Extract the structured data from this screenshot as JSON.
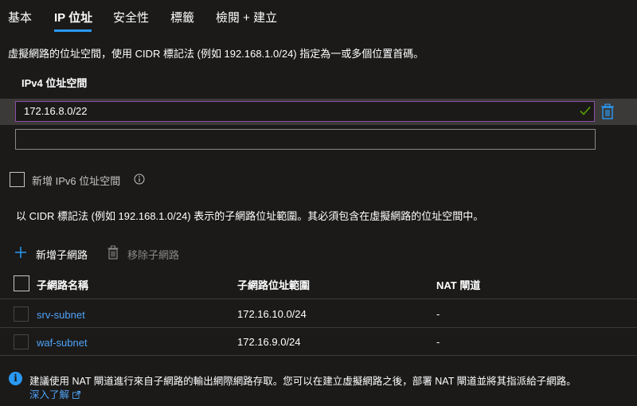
{
  "tabs": [
    {
      "label": "基本",
      "active": false
    },
    {
      "label": "IP 位址",
      "active": true
    },
    {
      "label": "安全性",
      "active": false
    },
    {
      "label": "標籤",
      "active": false
    },
    {
      "label": "檢閱 + 建立",
      "active": false
    }
  ],
  "address_space": {
    "description": "虛擬網路的位址空間，使用 CIDR 標記法 (例如 192.168.1.0/24) 指定為一或多個位置首碼。",
    "label": "IPv4 位址空間",
    "value": "172.16.8.0/22",
    "empty_value": ""
  },
  "ipv6": {
    "label": "新增 IPv6 位址空間",
    "checked": false
  },
  "subnet_description": "以 CIDR 標記法 (例如 192.168.1.0/24) 表示的子網路位址範圍。其必須包含在虛擬網路的位址空間中。",
  "toolbar": {
    "add_label": "新增子網路",
    "remove_label": "移除子網路"
  },
  "table": {
    "columns": [
      "子網路名稱",
      "子網路位址範圍",
      "NAT 閘道"
    ],
    "rows": [
      {
        "name": "srv-subnet",
        "range": "172.16.10.0/24",
        "nat": "-"
      },
      {
        "name": "waf-subnet",
        "range": "172.16.9.0/24",
        "nat": "-"
      }
    ]
  },
  "info": {
    "text": "建議使用 NAT 閘道進行來自子網路的輸出網際網路存取。您可以在建立虛擬網路之後，部署 NAT 閘道並將其指派給子網路。",
    "link": "深入了解"
  },
  "colors": {
    "background": "#1b1a19",
    "accent": "#2899f5",
    "link": "#4fa3f7",
    "valid_check": "#57a300"
  }
}
